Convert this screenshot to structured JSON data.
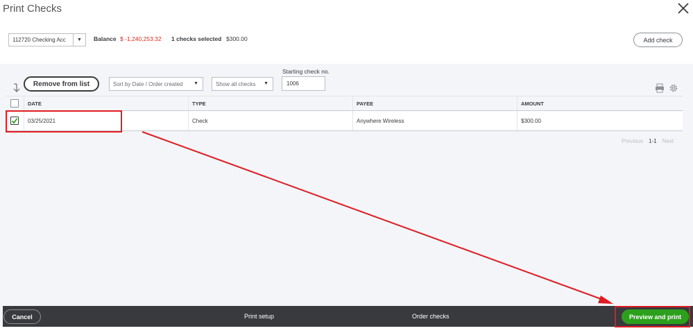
{
  "dialog": {
    "title": "Print Checks"
  },
  "account": {
    "selected": "112720 Checking Acc",
    "balance_label": "Balance",
    "balance_value": "$ -1,240,253.32",
    "selected_count": "1 checks selected",
    "selected_amount": "$300.00"
  },
  "toolbar": {
    "add_check": "Add check",
    "remove_from_list": "Remove from list",
    "sort_value": "Sort by Date / Order created",
    "filter_value": "Show all checks",
    "starting_check_label": "Starting check no.",
    "starting_check_value": "1006"
  },
  "table": {
    "headers": [
      "DATE",
      "TYPE",
      "PAYEE",
      "AMOUNT"
    ],
    "rows": [
      {
        "checked": true,
        "date": "03/25/2021",
        "type": "Check",
        "payee": "Anywhere Wireless",
        "amount": "$300.00"
      }
    ]
  },
  "pager": {
    "previous": "Previous",
    "range": "1-1",
    "next": "Next"
  },
  "footer": {
    "cancel": "Cancel",
    "print_setup": "Print setup",
    "order_checks": "Order checks",
    "preview_and_print": "Preview and print"
  },
  "colors": {
    "primary_green": "#2ca01c",
    "negative_red": "#d52b1e",
    "footer_bg": "#393a3d",
    "annotation_red": "#e11b22"
  },
  "icons": [
    "close-icon",
    "sort-arrow-icon",
    "chevron-down-icon",
    "printer-icon",
    "gear-icon",
    "checkmark-icon"
  ]
}
